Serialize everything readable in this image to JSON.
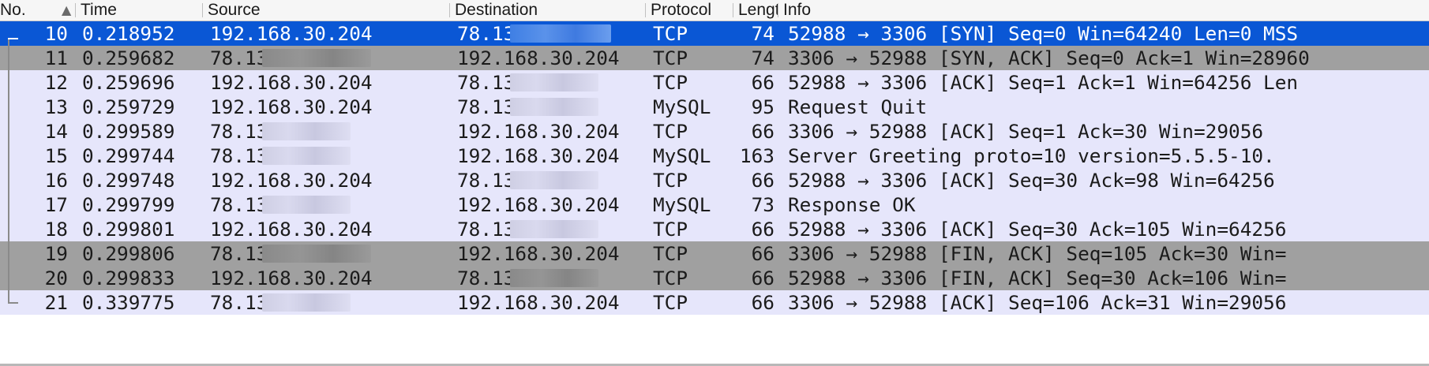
{
  "columns": {
    "no": "No.",
    "time": "Time",
    "source": "Source",
    "destination": "Destination",
    "protocol": "Protocol",
    "length": "Lengt",
    "info": "Info"
  },
  "sort_icon": "triangle-up-icon",
  "colors": {
    "row_bg": "#e6e6fb",
    "selected_bg": "#0a57d5",
    "marked_bg": "#a0a0a0"
  },
  "rows": [
    {
      "no": "10",
      "time": "0.218952",
      "source": "192.168.30.204",
      "destination": "78.13",
      "protocol": "TCP",
      "length": "74",
      "info": "52988 → 3306 [SYN] Seq=0 Win=64240 Len=0 MSS",
      "state": "selected"
    },
    {
      "no": "11",
      "time": "0.259682",
      "source": "78.13",
      "destination": "192.168.30.204",
      "protocol": "TCP",
      "length": "74",
      "info": "3306 → 52988 [SYN, ACK] Seq=0 Ack=1 Win=28960",
      "state": "marked"
    },
    {
      "no": "12",
      "time": "0.259696",
      "source": "192.168.30.204",
      "destination": "78.13",
      "protocol": "TCP",
      "length": "66",
      "info": "52988 → 3306 [ACK] Seq=1 Ack=1 Win=64256 Len",
      "state": "normal"
    },
    {
      "no": "13",
      "time": "0.259729",
      "source": "192.168.30.204",
      "destination": "78.13",
      "protocol": "MySQL",
      "length": "95",
      "info": "Request Quit",
      "state": "normal"
    },
    {
      "no": "14",
      "time": "0.299589",
      "source": "78.13",
      "destination": "192.168.30.204",
      "protocol": "TCP",
      "length": "66",
      "info": "3306 → 52988 [ACK] Seq=1 Ack=30 Win=29056",
      "state": "normal"
    },
    {
      "no": "15",
      "time": "0.299744",
      "source": "78.13",
      "destination": "192.168.30.204",
      "protocol": "MySQL",
      "length": "163",
      "info": "Server Greeting proto=10 version=5.5.5-10.",
      "state": "normal"
    },
    {
      "no": "16",
      "time": "0.299748",
      "source": "192.168.30.204",
      "destination": "78.13",
      "protocol": "TCP",
      "length": "66",
      "info": "52988 → 3306 [ACK] Seq=30 Ack=98 Win=64256",
      "state": "normal"
    },
    {
      "no": "17",
      "time": "0.299799",
      "source": "78.13",
      "destination": "192.168.30.204",
      "protocol": "MySQL",
      "length": "73",
      "info": "Response OK",
      "state": "normal"
    },
    {
      "no": "18",
      "time": "0.299801",
      "source": "192.168.30.204",
      "destination": "78.13",
      "protocol": "TCP",
      "length": "66",
      "info": "52988 → 3306 [ACK] Seq=30 Ack=105 Win=64256",
      "state": "normal"
    },
    {
      "no": "19",
      "time": "0.299806",
      "source": "78.13",
      "destination": "192.168.30.204",
      "protocol": "TCP",
      "length": "66",
      "info": "3306 → 52988 [FIN, ACK] Seq=105 Ack=30 Win=",
      "state": "marked"
    },
    {
      "no": "20",
      "time": "0.299833",
      "source": "192.168.30.204",
      "destination": "78.13",
      "protocol": "TCP",
      "length": "66",
      "info": "52988 → 3306 [FIN, ACK] Seq=30 Ack=106 Win=",
      "state": "marked"
    },
    {
      "no": "21",
      "time": "0.339775",
      "source": "78.13",
      "destination": "192.168.30.204",
      "protocol": "TCP",
      "length": "66",
      "info": "3306 → 52988 [ACK] Seq=106 Ack=31 Win=29056",
      "state": "normal"
    }
  ]
}
